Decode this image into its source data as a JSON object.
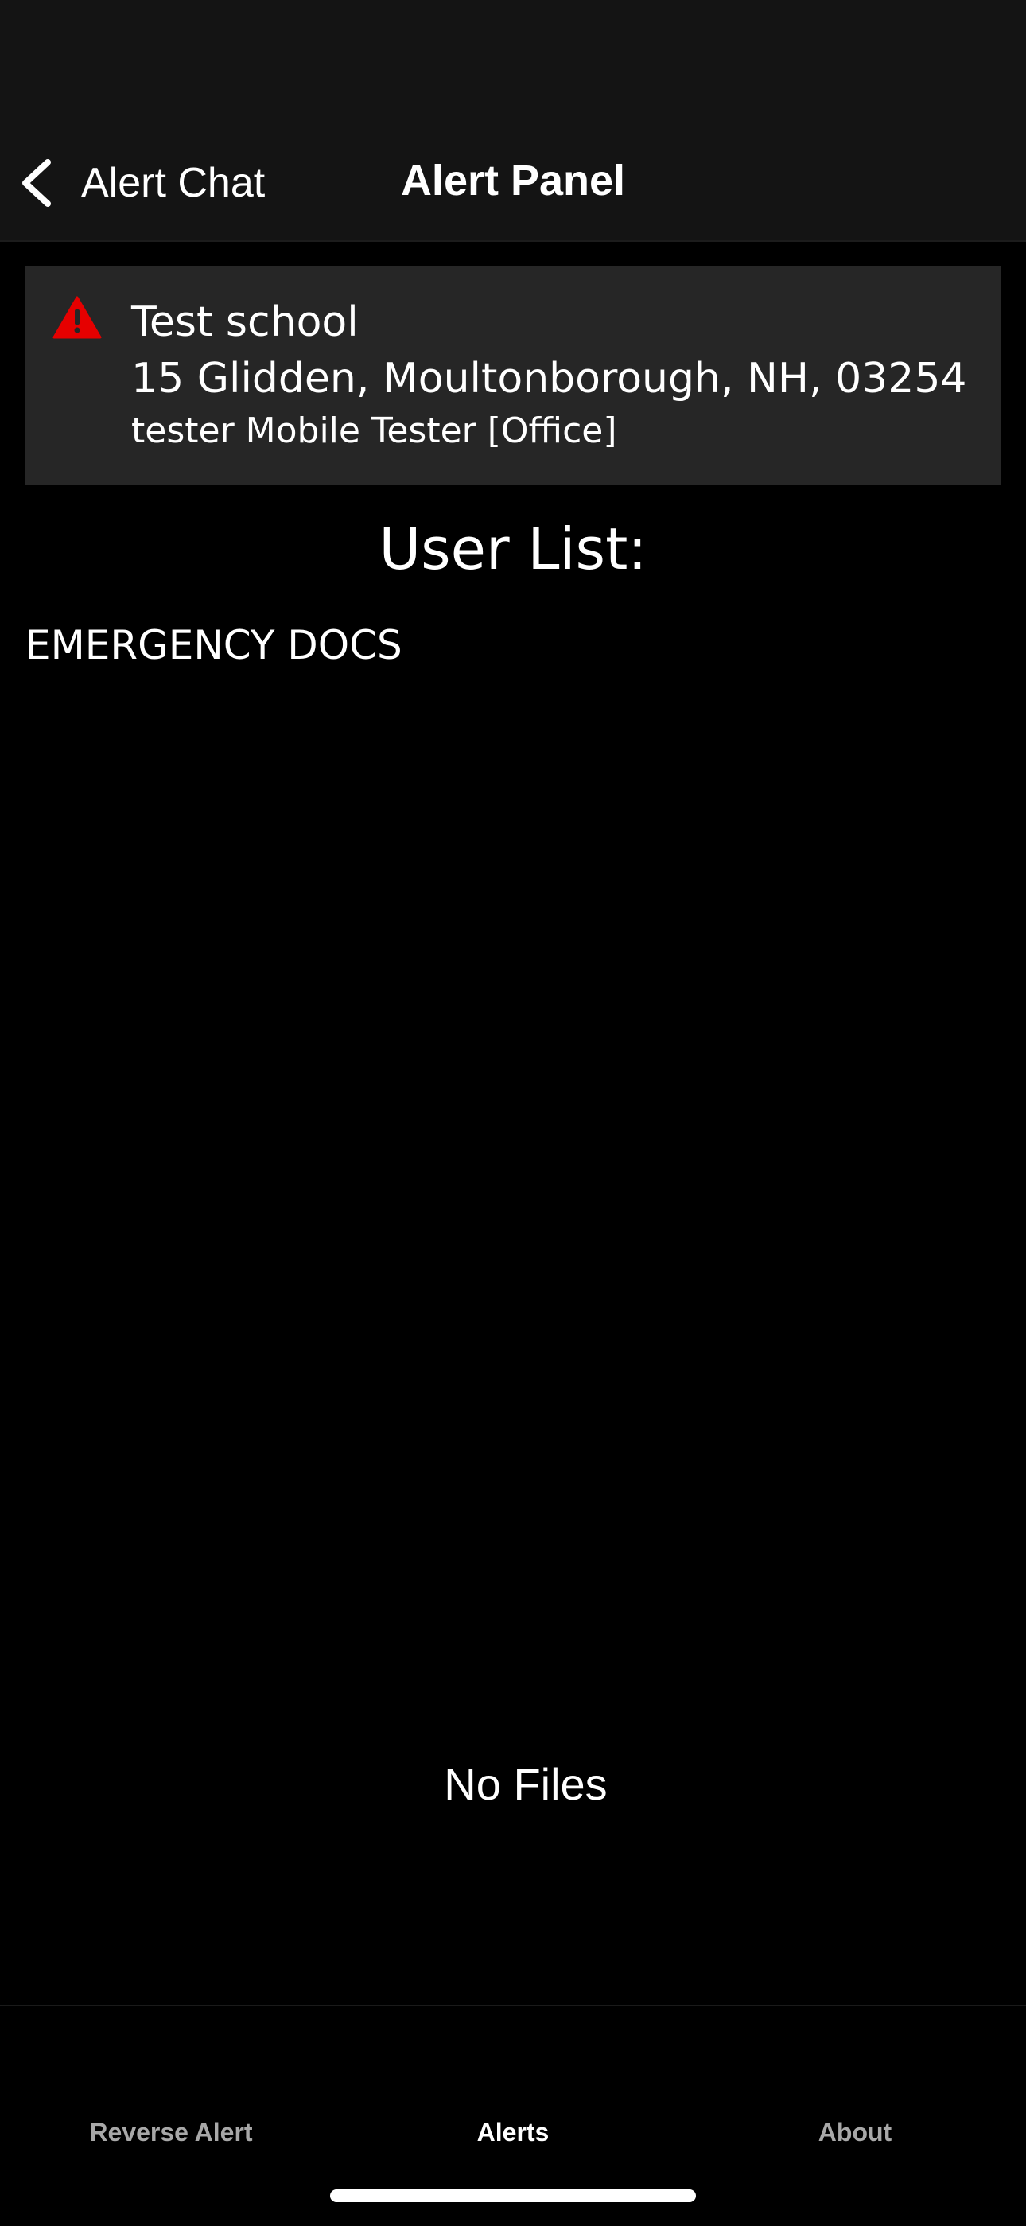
{
  "header": {
    "back_label": "Alert Chat",
    "title": "Alert Panel",
    "back_icon": "chevron-left-icon"
  },
  "alert": {
    "icon": "warning-triangle-icon",
    "icon_color": "#e60000",
    "name": "Test school",
    "address": "15 Glidden, Moultonborough, NH, 03254",
    "user": "tester Mobile Tester [Office]"
  },
  "main": {
    "section_title": "User List:",
    "docs_heading": "EMERGENCY DOCS",
    "empty_message": "No Files"
  },
  "tabs": [
    {
      "label": "Reverse Alert",
      "active": false
    },
    {
      "label": "Alerts",
      "active": true
    },
    {
      "label": "About",
      "active": false
    }
  ],
  "colors": {
    "background": "#000000",
    "header_background": "#141414",
    "card_background": "#262626",
    "inactive_tab": "#a8a8a8"
  }
}
